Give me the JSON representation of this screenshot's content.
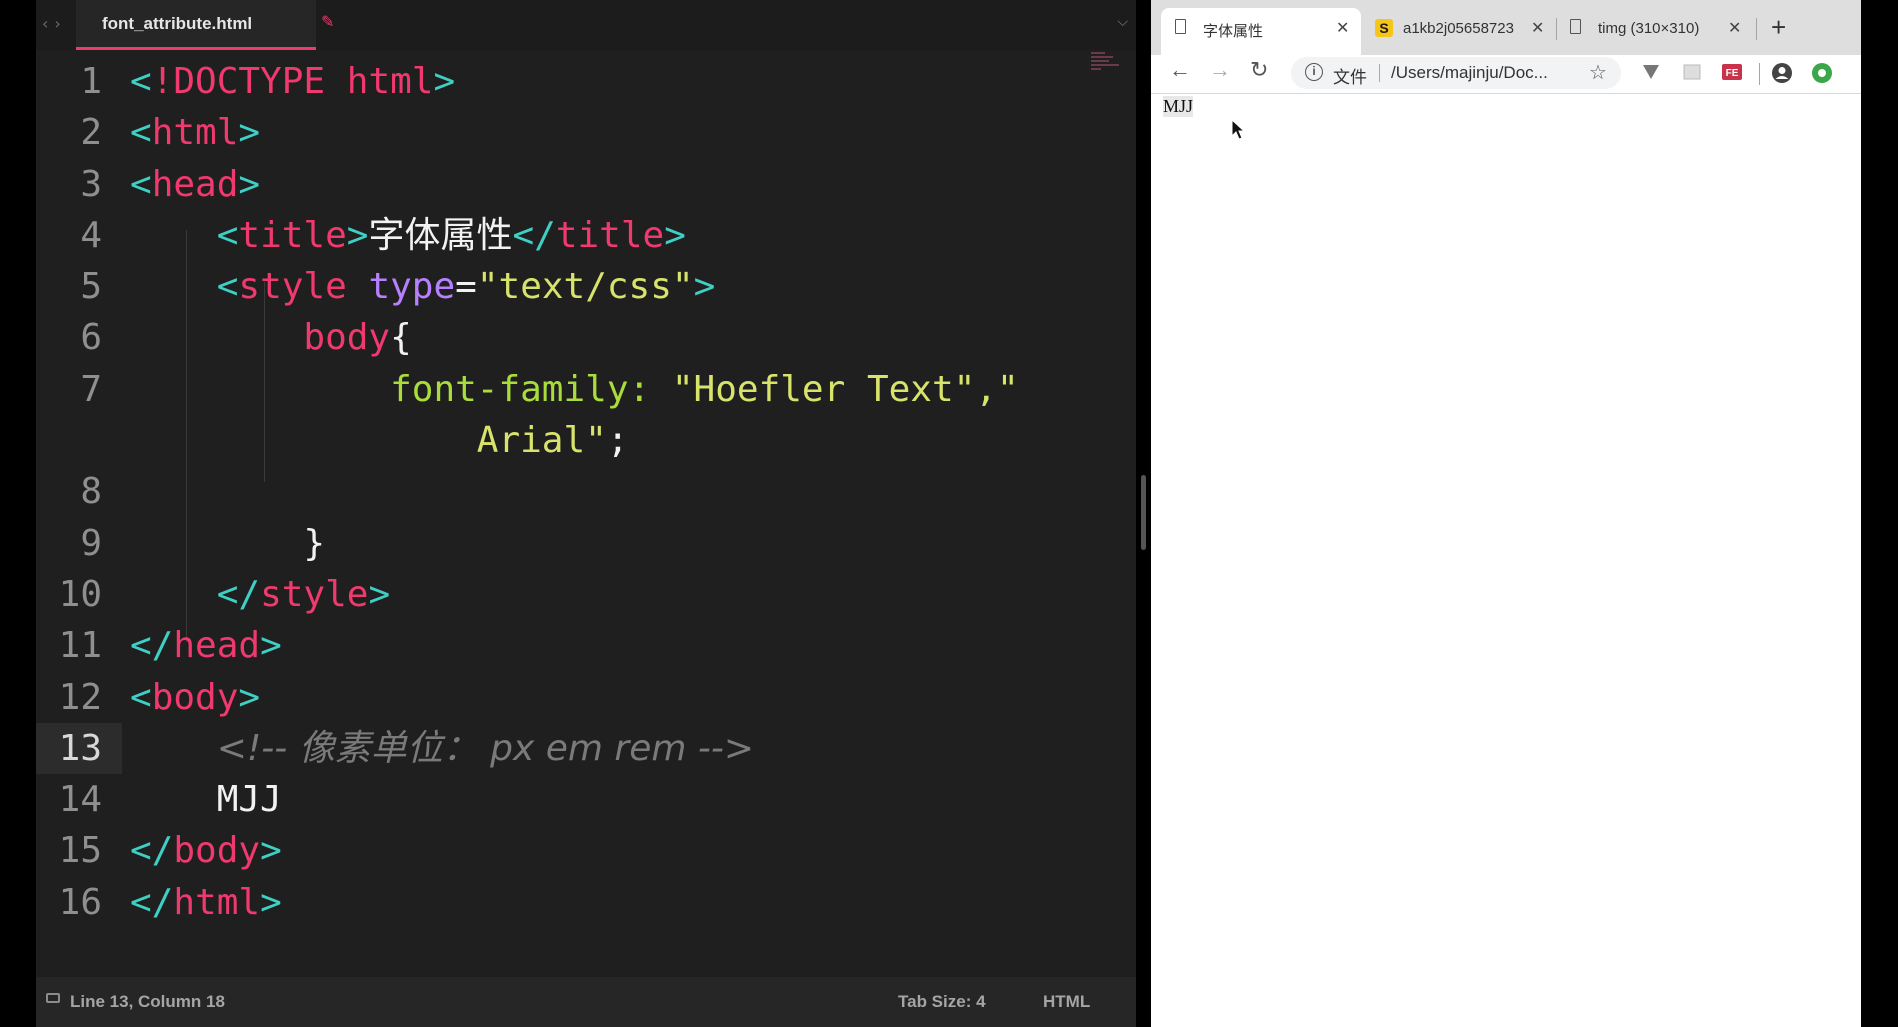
{
  "editor": {
    "tab_title": "font_attribute.html",
    "lines": [
      {
        "n": "1"
      },
      {
        "n": "2"
      },
      {
        "n": "3"
      },
      {
        "n": "4"
      },
      {
        "n": "5"
      },
      {
        "n": "6"
      },
      {
        "n": "7"
      },
      {
        "n": ""
      },
      {
        "n": "8"
      },
      {
        "n": "9"
      },
      {
        "n": "10"
      },
      {
        "n": "11"
      },
      {
        "n": "12"
      },
      {
        "n": "13"
      },
      {
        "n": "14"
      },
      {
        "n": "15"
      },
      {
        "n": "16"
      }
    ],
    "tokens": {
      "doctype": "!DOCTYPE",
      "html": "html",
      "head": "head",
      "title": "title",
      "title_text": "字体属性",
      "style": "style",
      "type_attr": "type",
      "type_value": "\"text/css\"",
      "body_selector": "body",
      "font_family_prop": "font-family:",
      "font_value_1": "\"Hoefler Text\",\"",
      "font_value_2": "Arial\"",
      "body": "body",
      "comment": "<!-- 像素单位： px em rem -->",
      "content": "MJJ"
    }
  },
  "status": {
    "position": "Line 13, Column 18",
    "tab_size": "Tab Size: 4",
    "syntax": "HTML"
  },
  "browser": {
    "tabs": [
      {
        "label": "字体属性"
      },
      {
        "label": "a1kb2j05658723"
      },
      {
        "label": "timg (310×310)"
      }
    ],
    "omnibox": {
      "file_label": "文件",
      "url": "/Users/majinju/Doc..."
    },
    "page_text": "MJJ"
  },
  "colors": {
    "editor_bg": "#1f1f1f",
    "tag": "#f0396e",
    "bracket": "#3fd0c5",
    "attribute": "#b680ff",
    "string": "#d8e36b",
    "property": "#a8dd3b"
  }
}
